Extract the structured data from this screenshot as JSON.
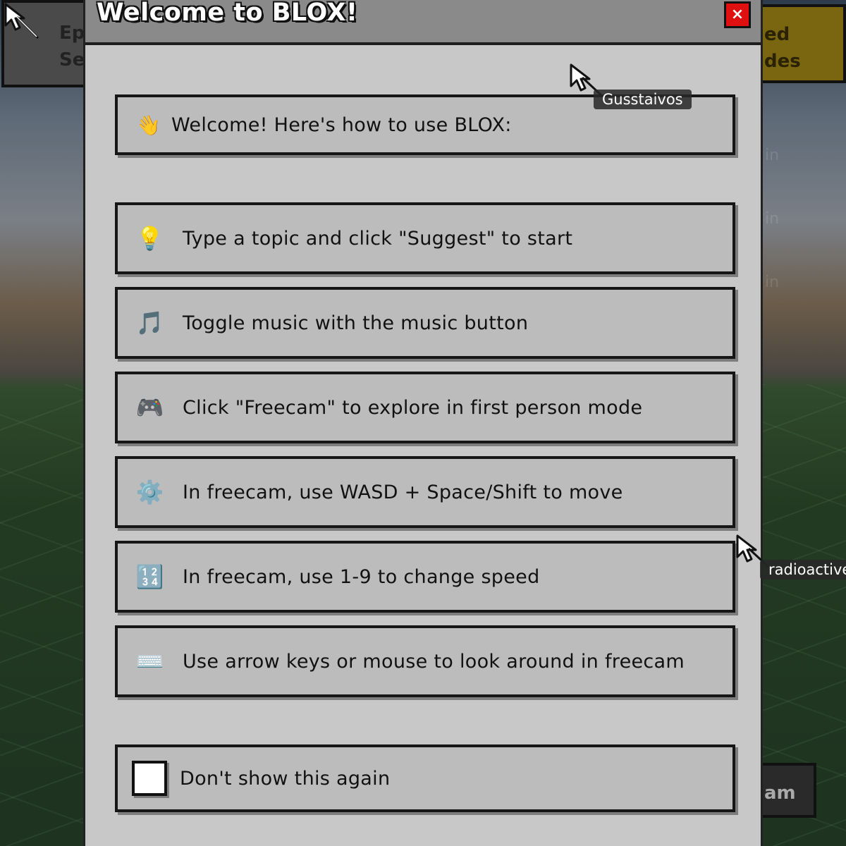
{
  "background": {
    "left_button": "Ep\nSe",
    "right_button": "ed\ndes",
    "cam_button": "am",
    "faint_labels": [
      "in",
      "in",
      "in"
    ]
  },
  "modal": {
    "title": "Welcome to BLOX!",
    "close_label": "×",
    "welcome_text": "Welcome! Here's how to use BLOX:",
    "welcome_icon": "👋",
    "items": [
      {
        "icon": "💡",
        "icon_name": "lightbulb-icon",
        "text": "Type a topic and click \"Suggest\" to start"
      },
      {
        "icon": "🎵",
        "icon_name": "music-note-icon",
        "text": "Toggle music with the music button"
      },
      {
        "icon": "🎮",
        "icon_name": "gamepad-icon",
        "text": "Click \"Freecam\" to explore in first person mode"
      },
      {
        "icon": "⚙️",
        "icon_name": "gear-icon",
        "text": "In freecam, use WASD + Space/Shift to move"
      },
      {
        "icon": "🔢",
        "icon_name": "numbers-icon",
        "text": "In freecam, use 1-9 to change speed"
      },
      {
        "icon": "⌨️",
        "icon_name": "keyboard-icon",
        "text": "Use arrow keys or mouse to look around in freecam"
      }
    ],
    "dont_show_label": "Don't show this again"
  },
  "cursors": [
    {
      "name": "Gusstaivos"
    },
    {
      "name": "radioactive"
    }
  ],
  "colors": {
    "close_button": "#e01010",
    "modal_bg": "#c8c8c8",
    "card_bg": "#bcbcbc",
    "header_bg": "#8a8a8a"
  }
}
